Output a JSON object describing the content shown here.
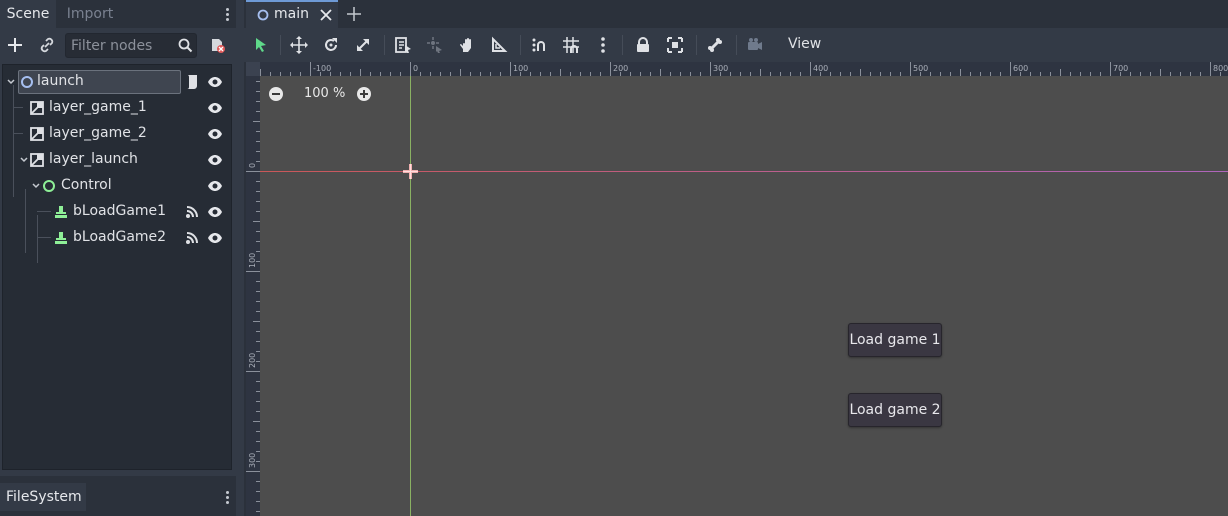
{
  "scene_dock": {
    "tabs": [
      {
        "label": "Scene"
      },
      {
        "label": "Import"
      }
    ],
    "filter": {
      "placeholder": "Filter nodes",
      "value": ""
    },
    "tree": [
      {
        "label": "launch",
        "icon": "node2d-circle-icon",
        "selected": true,
        "has_script": true
      },
      {
        "label": "layer_game_1",
        "icon": "canvas-layer-icon"
      },
      {
        "label": "layer_game_2",
        "icon": "canvas-layer-icon"
      },
      {
        "label": "layer_launch",
        "icon": "canvas-layer-icon"
      },
      {
        "label": "Control",
        "icon": "control-circle-icon"
      },
      {
        "label": "bLoadGame1",
        "icon": "button-icon",
        "has_signals": true
      },
      {
        "label": "bLoadGame2",
        "icon": "button-icon",
        "has_signals": true
      }
    ]
  },
  "filesystem_dock": {
    "tab_label": "FileSystem"
  },
  "editor": {
    "document_tabs": [
      {
        "label": "main"
      }
    ],
    "toolbar": {
      "view_menu": "View"
    },
    "zoom": {
      "label": "100 %"
    },
    "ruler_h": [
      "-100",
      "0",
      "100",
      "200",
      "300",
      "400",
      "500",
      "600",
      "700",
      "800"
    ],
    "ruler_v": [
      "0",
      "100",
      "200",
      "300"
    ],
    "buttons": [
      {
        "label": "Load game 1"
      },
      {
        "label": "Load game 2"
      }
    ]
  },
  "colors": {
    "accent": "#6e9ad6",
    "viewport_bg": "#4d4d4d",
    "panel_bg": "#333a46",
    "axis_x": "#e05a5a",
    "axis_y": "#9fd36b"
  }
}
